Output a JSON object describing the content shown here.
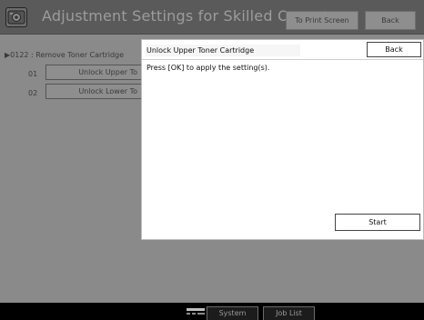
{
  "header": {
    "title": "Adjustment Settings for Skilled Operators",
    "print_screen_label": "To Print Screen",
    "back_label": "Back"
  },
  "background_list": {
    "header": "▶0122 : Remove Toner Cartridge",
    "rows": [
      {
        "number": "01",
        "label": "Unlock Upper To"
      },
      {
        "number": "02",
        "label": "Unlock Lower To"
      }
    ]
  },
  "dialog": {
    "title": "Unlock Upper Toner Cartridge",
    "back_label": "Back",
    "message": "Press [OK] to apply the setting(s).",
    "start_label": "Start"
  },
  "footer": {
    "system_status_label": "System Status",
    "job_list_label": "Job List"
  },
  "icons": {
    "app": "copier-settings-icon",
    "status": "status-indicator-icon"
  },
  "colors": {
    "background": "#8a8a8a",
    "titlebar": "#5a5a5a",
    "dialog": "#ffffff",
    "bottombar": "#000000"
  }
}
